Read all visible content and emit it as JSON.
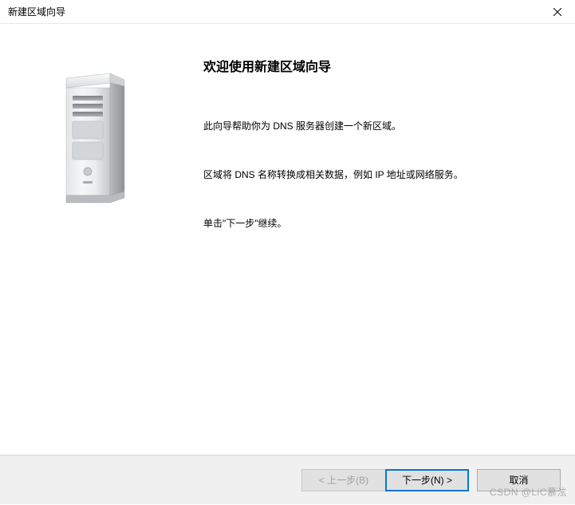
{
  "titlebar": {
    "title": "新建区域向导"
  },
  "wizard": {
    "heading": "欢迎使用新建区域向导",
    "paragraph1": "此向导帮助你为 DNS 服务器创建一个新区域。",
    "paragraph2": "区域将 DNS 名称转换成相关数据，例如 IP 地址或网络服务。",
    "paragraph3": "单击\"下一步\"继续。"
  },
  "buttons": {
    "back": "< 上一步(B)",
    "next": "下一步(N) >",
    "cancel": "取消"
  },
  "icons": {
    "server": "server-tower-icon",
    "close": "close-icon"
  },
  "watermark": "CSDN @LiC慕泫"
}
